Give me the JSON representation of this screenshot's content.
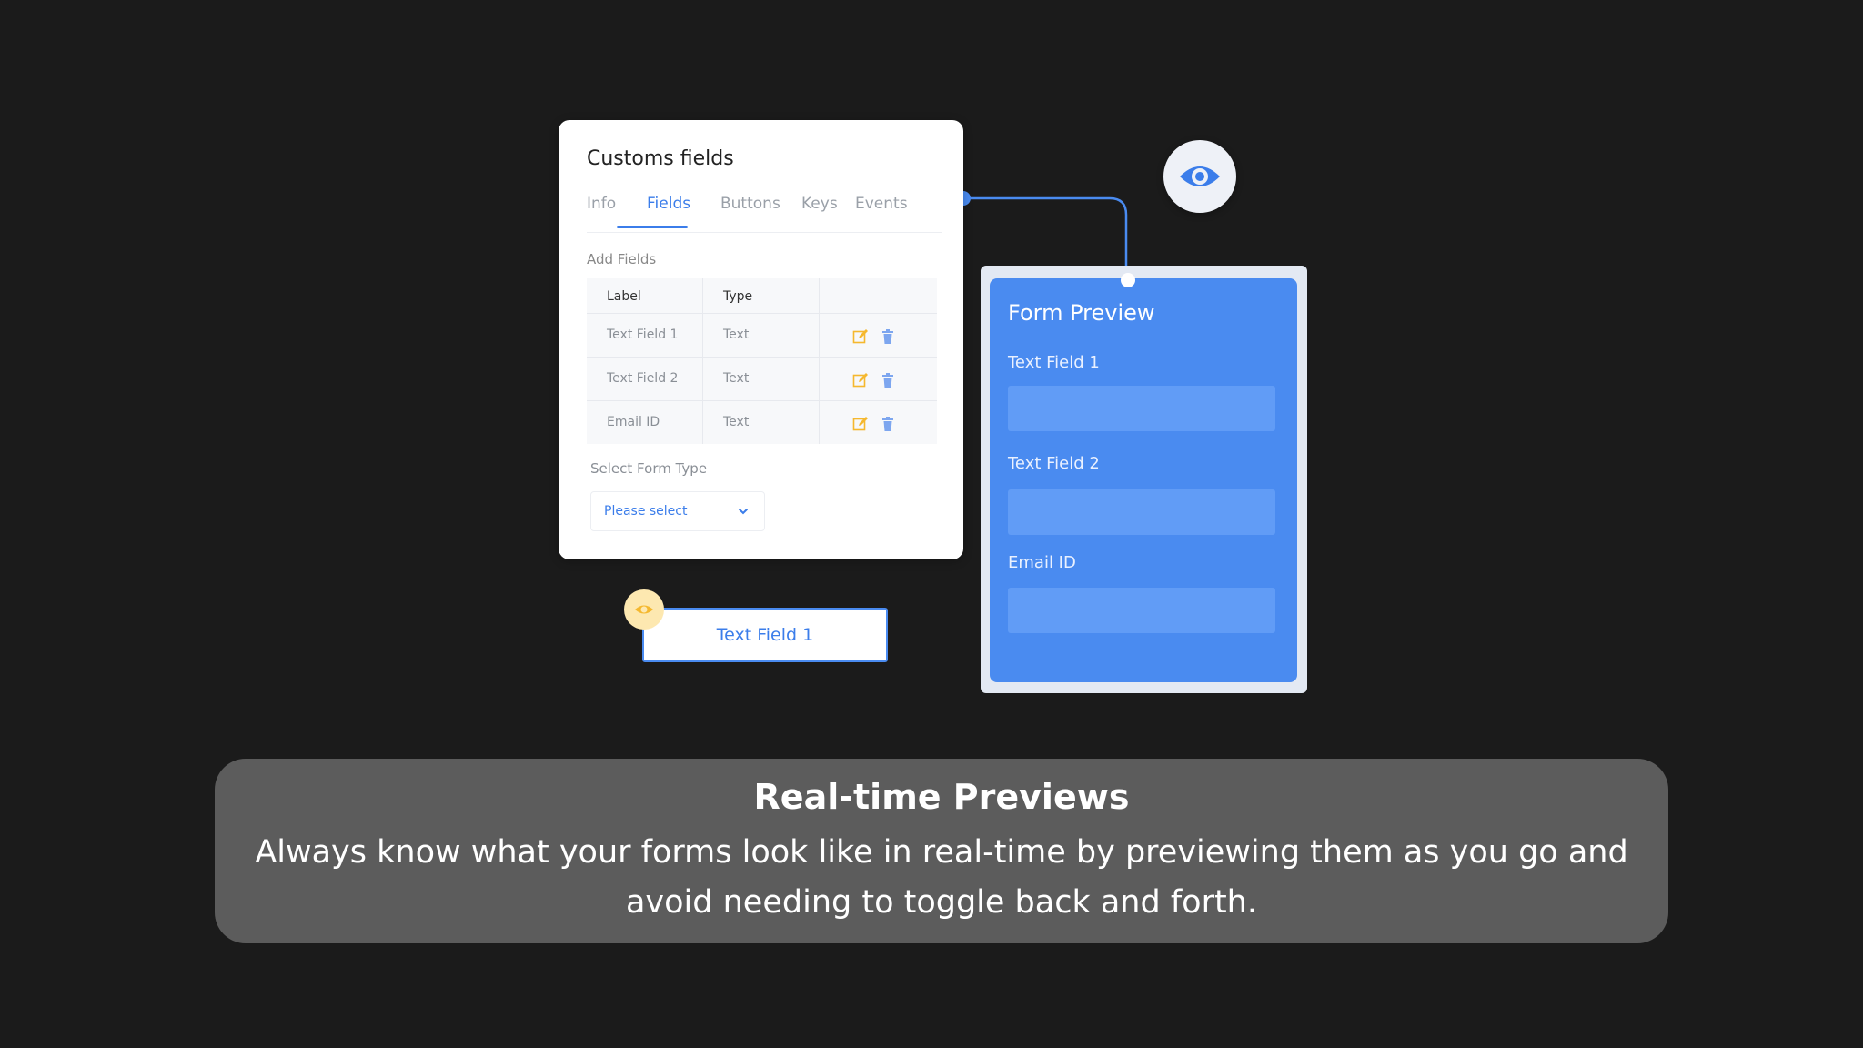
{
  "fields_card": {
    "title": "Customs fields",
    "tabs": [
      "Info",
      "Fields",
      "Buttons",
      "Keys",
      "Events"
    ],
    "active_tab": "Fields",
    "add_fields_label": "Add Fields",
    "table": {
      "headers": [
        "Label",
        "Type"
      ],
      "rows": [
        {
          "label": "Text Field 1",
          "type": "Text"
        },
        {
          "label": "Text Field 2",
          "type": "Text"
        },
        {
          "label": "Email ID",
          "type": "Text"
        }
      ]
    },
    "select_form_type_label": "Select Form Type",
    "select_placeholder": "Please select"
  },
  "form_preview": {
    "title": "Form Preview",
    "fields": [
      "Text Field 1",
      "Text Field 2",
      "Email ID"
    ]
  },
  "floating_chip": {
    "label": "Text Field 1"
  },
  "caption": {
    "title": "Real-time Previews",
    "body": "Always know what your forms look like in real-time by previewing them as you go and avoid needing to toggle back and forth."
  },
  "colors": {
    "accent": "#3b7dea",
    "preview_panel": "#4a8bf0",
    "edit_icon": "#f5b82e",
    "background": "#1b1b1b",
    "caption_bg": "#5c5c5c"
  },
  "icons": {
    "preview": "eye-icon",
    "edit": "edit-icon",
    "delete": "trash-icon",
    "dropdown": "chevron-down-icon"
  }
}
